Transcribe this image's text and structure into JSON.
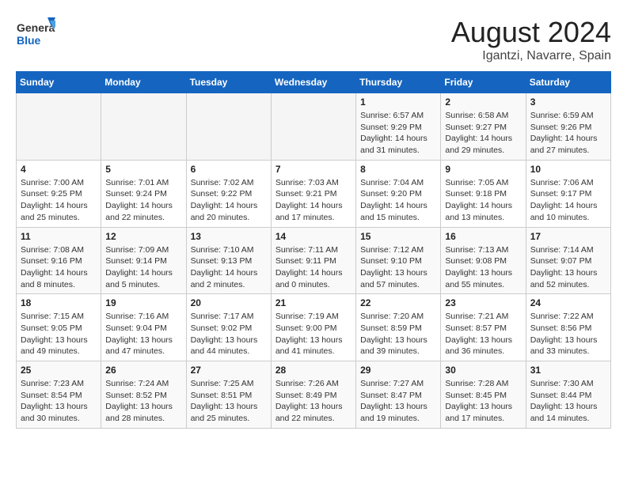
{
  "header": {
    "logo_general": "General",
    "logo_blue": "Blue",
    "month_year": "August 2024",
    "location": "Igantzi, Navarre, Spain"
  },
  "weekdays": [
    "Sunday",
    "Monday",
    "Tuesday",
    "Wednesday",
    "Thursday",
    "Friday",
    "Saturday"
  ],
  "weeks": [
    [
      {
        "day": "",
        "info": ""
      },
      {
        "day": "",
        "info": ""
      },
      {
        "day": "",
        "info": ""
      },
      {
        "day": "",
        "info": ""
      },
      {
        "day": "1",
        "info": "Sunrise: 6:57 AM\nSunset: 9:29 PM\nDaylight: 14 hours and 31 minutes."
      },
      {
        "day": "2",
        "info": "Sunrise: 6:58 AM\nSunset: 9:27 PM\nDaylight: 14 hours and 29 minutes."
      },
      {
        "day": "3",
        "info": "Sunrise: 6:59 AM\nSunset: 9:26 PM\nDaylight: 14 hours and 27 minutes."
      }
    ],
    [
      {
        "day": "4",
        "info": "Sunrise: 7:00 AM\nSunset: 9:25 PM\nDaylight: 14 hours and 25 minutes."
      },
      {
        "day": "5",
        "info": "Sunrise: 7:01 AM\nSunset: 9:24 PM\nDaylight: 14 hours and 22 minutes."
      },
      {
        "day": "6",
        "info": "Sunrise: 7:02 AM\nSunset: 9:22 PM\nDaylight: 14 hours and 20 minutes."
      },
      {
        "day": "7",
        "info": "Sunrise: 7:03 AM\nSunset: 9:21 PM\nDaylight: 14 hours and 17 minutes."
      },
      {
        "day": "8",
        "info": "Sunrise: 7:04 AM\nSunset: 9:20 PM\nDaylight: 14 hours and 15 minutes."
      },
      {
        "day": "9",
        "info": "Sunrise: 7:05 AM\nSunset: 9:18 PM\nDaylight: 14 hours and 13 minutes."
      },
      {
        "day": "10",
        "info": "Sunrise: 7:06 AM\nSunset: 9:17 PM\nDaylight: 14 hours and 10 minutes."
      }
    ],
    [
      {
        "day": "11",
        "info": "Sunrise: 7:08 AM\nSunset: 9:16 PM\nDaylight: 14 hours and 8 minutes."
      },
      {
        "day": "12",
        "info": "Sunrise: 7:09 AM\nSunset: 9:14 PM\nDaylight: 14 hours and 5 minutes."
      },
      {
        "day": "13",
        "info": "Sunrise: 7:10 AM\nSunset: 9:13 PM\nDaylight: 14 hours and 2 minutes."
      },
      {
        "day": "14",
        "info": "Sunrise: 7:11 AM\nSunset: 9:11 PM\nDaylight: 14 hours and 0 minutes."
      },
      {
        "day": "15",
        "info": "Sunrise: 7:12 AM\nSunset: 9:10 PM\nDaylight: 13 hours and 57 minutes."
      },
      {
        "day": "16",
        "info": "Sunrise: 7:13 AM\nSunset: 9:08 PM\nDaylight: 13 hours and 55 minutes."
      },
      {
        "day": "17",
        "info": "Sunrise: 7:14 AM\nSunset: 9:07 PM\nDaylight: 13 hours and 52 minutes."
      }
    ],
    [
      {
        "day": "18",
        "info": "Sunrise: 7:15 AM\nSunset: 9:05 PM\nDaylight: 13 hours and 49 minutes."
      },
      {
        "day": "19",
        "info": "Sunrise: 7:16 AM\nSunset: 9:04 PM\nDaylight: 13 hours and 47 minutes."
      },
      {
        "day": "20",
        "info": "Sunrise: 7:17 AM\nSunset: 9:02 PM\nDaylight: 13 hours and 44 minutes."
      },
      {
        "day": "21",
        "info": "Sunrise: 7:19 AM\nSunset: 9:00 PM\nDaylight: 13 hours and 41 minutes."
      },
      {
        "day": "22",
        "info": "Sunrise: 7:20 AM\nSunset: 8:59 PM\nDaylight: 13 hours and 39 minutes."
      },
      {
        "day": "23",
        "info": "Sunrise: 7:21 AM\nSunset: 8:57 PM\nDaylight: 13 hours and 36 minutes."
      },
      {
        "day": "24",
        "info": "Sunrise: 7:22 AM\nSunset: 8:56 PM\nDaylight: 13 hours and 33 minutes."
      }
    ],
    [
      {
        "day": "25",
        "info": "Sunrise: 7:23 AM\nSunset: 8:54 PM\nDaylight: 13 hours and 30 minutes."
      },
      {
        "day": "26",
        "info": "Sunrise: 7:24 AM\nSunset: 8:52 PM\nDaylight: 13 hours and 28 minutes."
      },
      {
        "day": "27",
        "info": "Sunrise: 7:25 AM\nSunset: 8:51 PM\nDaylight: 13 hours and 25 minutes."
      },
      {
        "day": "28",
        "info": "Sunrise: 7:26 AM\nSunset: 8:49 PM\nDaylight: 13 hours and 22 minutes."
      },
      {
        "day": "29",
        "info": "Sunrise: 7:27 AM\nSunset: 8:47 PM\nDaylight: 13 hours and 19 minutes."
      },
      {
        "day": "30",
        "info": "Sunrise: 7:28 AM\nSunset: 8:45 PM\nDaylight: 13 hours and 17 minutes."
      },
      {
        "day": "31",
        "info": "Sunrise: 7:30 AM\nSunset: 8:44 PM\nDaylight: 13 hours and 14 minutes."
      }
    ]
  ]
}
